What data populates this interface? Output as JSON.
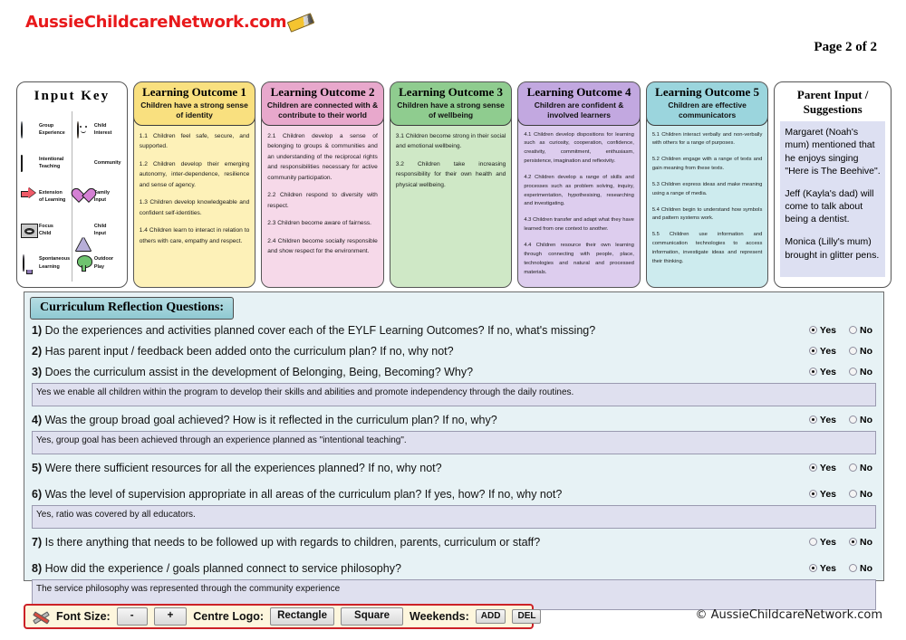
{
  "header": {
    "site_logo": "AussieChildcareNetwork.com",
    "page_label": "Page 2 of 2"
  },
  "input_key": {
    "title": "Input  Key",
    "left_items": [
      {
        "icon": "cloud-icon",
        "label": "Group\nExperience"
      },
      {
        "icon": "book-icon",
        "label": "Intentional\nTeaching"
      },
      {
        "icon": "arrow-icon",
        "label": "Extension\nof Learning"
      },
      {
        "icon": "eye-icon",
        "label": "Focus\nChild"
      },
      {
        "icon": "lightbulb-icon",
        "label": "Spontaneous\nLearning"
      }
    ],
    "right_items": [
      {
        "icon": "face-icon",
        "label": "Child\nInterest"
      },
      {
        "icon": "star-icon",
        "label": "Community"
      },
      {
        "icon": "heart-icon",
        "label": "Family\nInput"
      },
      {
        "icon": "triangle-icon",
        "label": "Child\nInput"
      },
      {
        "icon": "tree-icon",
        "label": "Outdoor\nPlay"
      }
    ]
  },
  "outcomes": [
    {
      "title": "Learning Outcome 1",
      "subtitle": "Children have a strong sense of identity",
      "header_color": "#f9e07f",
      "body_color": "#fdf1b8",
      "items": [
        "1.1 Children feel safe, secure, and supported.",
        "1.2 Children develop their emerging autonomy, inter-dependence, resilience and sense of agency.",
        "1.3 Children develop knowledgeable and confident self-identities.",
        "1.4 Children learn to interact in relation to others with care, empathy and respect."
      ]
    },
    {
      "title": "Learning Outcome 2",
      "subtitle": "Children are connected with & contribute to their world",
      "header_color": "#e8a8cc",
      "body_color": "#f6d9e9",
      "items": [
        "2.1 Children develop a sense of belonging to groups & communities and an understanding of the reciprocal rights and responsibilities necessary for active community participation.",
        "2.2 Children respond to diversity with respect.",
        "2.3 Children become aware of fairness.",
        "2.4 Children become socially responsible and show respect for the environment."
      ]
    },
    {
      "title": "Learning Outcome 3",
      "subtitle": "Children have a strong sense of wellbeing",
      "header_color": "#8fcc8f",
      "body_color": "#cfe8c6",
      "items": [
        "3.1 Children become strong in their social and emotional wellbeing.",
        "3.2 Children take increasing responsibility for their own health and physical wellbeing."
      ]
    },
    {
      "title": "Learning Outcome 4",
      "subtitle": "Children are confident & involved learners",
      "header_color": "#c2a8e0",
      "body_color": "#ddcdee",
      "items": [
        "4.1 Children develop dispositions for learning such as curiosity, cooperation, confidence, creativity, commitment, enthusiasm, persistence, imagination and reflexivity.",
        "4.2 Children develop a range of skills and processes such as problem solving, inquiry, experimentation, hypothesising, researching and investigating.",
        "4.3 Children transfer and adapt what they have learned from one context to another.",
        "4.4 Children resource their own learning through connecting with people, place, technologies and natural and processed materials."
      ]
    },
    {
      "title": "Learning Outcome 5",
      "subtitle": "Children are effective communicators",
      "header_color": "#9bd5dd",
      "body_color": "#cdebee",
      "items": [
        "5.1 Children interact verbally and non-verbally with others for a range of purposes.",
        "5.2 Children engage with a range of texts and gain meaning from these texts.",
        "5.3 Children express ideas and make meaning using a range of media.",
        "5.4 Children begin to understand how symbols and pattern systems work.",
        "5.5 Children use information and communication technologies to access information, investigate ideas and represent their thinking."
      ]
    }
  ],
  "parent_input": {
    "title": "Parent Input / Suggestions",
    "entries": [
      "Margaret (Noah's mum) mentioned that he enjoys singing \"Here is The Beehive\".",
      "Jeff (Kayla's dad) will come to talk about being a dentist.",
      "Monica (Lilly's mum) brought in glitter pens."
    ]
  },
  "reflection": {
    "title": "Curriculum Reflection Questions:",
    "yes_label": "Yes",
    "no_label": "No",
    "questions": [
      {
        "num": "1)",
        "text": "Do the experiences and activities planned cover each of the EYLF Learning Outcomes? If no, what's missing?",
        "answer_selected": "Yes",
        "answer_text": null
      },
      {
        "num": "2)",
        "text": "Has parent input / feedback been added onto the curriculum plan? If no, why not?",
        "answer_selected": "Yes",
        "answer_text": null
      },
      {
        "num": "3)",
        "text": "Does the curriculum assist in the development of Belonging, Being, Becoming? Why?",
        "answer_selected": "Yes",
        "answer_text": "Yes we enable all children within the program to develop their skills and abilities and promote independency through the daily routines."
      },
      {
        "num": "4)",
        "text": "Was the group broad goal achieved? How is it reflected in the curriculum plan? If no, why?",
        "answer_selected": "Yes",
        "answer_text": "Yes, group goal has been achieved through an experience planned as \"intentional teaching\"."
      },
      {
        "num": "5)",
        "text": "Were there sufficient resources for all the experiences planned? If no, why not?",
        "answer_selected": "Yes",
        "answer_text": null
      },
      {
        "num": "6)",
        "text": "Was the level of supervision appropriate in all areas of the curriculum plan? If yes, how? If no, why not?",
        "answer_selected": "Yes",
        "answer_text": "Yes, ratio was covered by all educators."
      },
      {
        "num": "7)",
        "text": "Is there anything that needs to be followed up with regards to children, parents, curriculum or staff?",
        "answer_selected": "No",
        "answer_text": null
      },
      {
        "num": "8)",
        "text": "How did the experience / goals planned connect to service philosophy?",
        "answer_selected": "Yes",
        "answer_text": "The service philosophy was represented through the community experience"
      }
    ]
  },
  "toolbar": {
    "tool_icon": "tools-icon",
    "font_size_label": "Font Size:",
    "font_minus": "-",
    "font_plus": "+",
    "centre_logo_label": "Centre Logo:",
    "logo_rectangle": "Rectangle",
    "logo_square": "Square",
    "weekends_label": "Weekends:",
    "weekends_add": "ADD",
    "weekends_del": "DEL"
  },
  "footer": {
    "copyright": "© AussieChildcareNetwork.com"
  }
}
